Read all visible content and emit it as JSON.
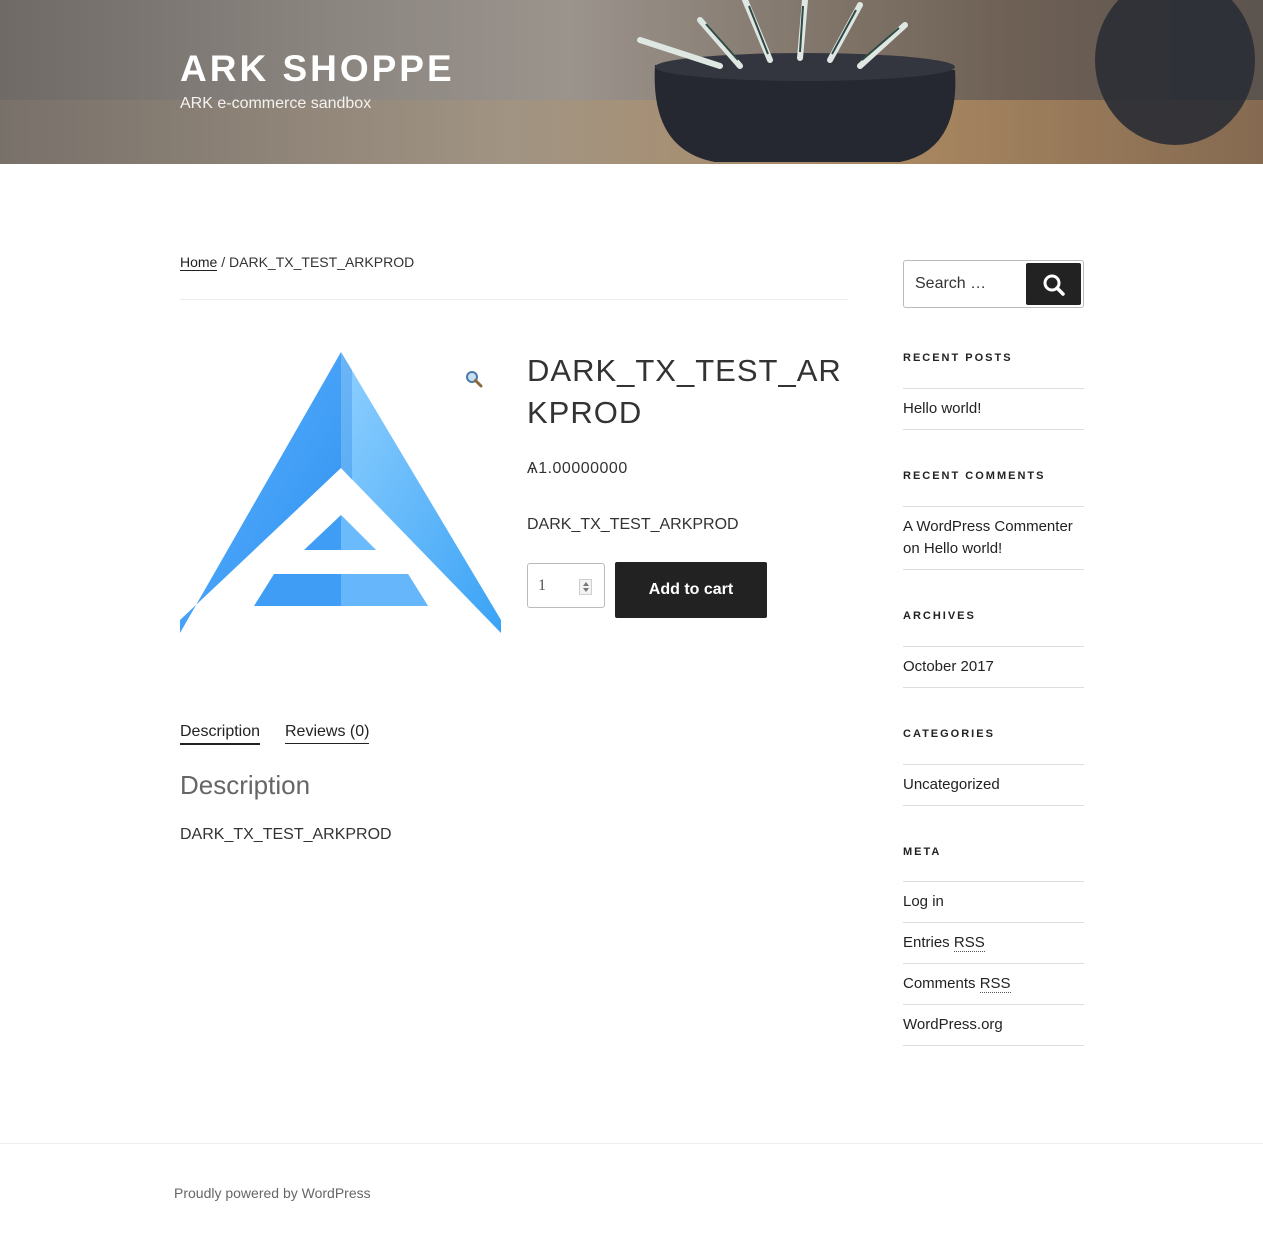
{
  "site": {
    "title": "ARK SHOPPE",
    "description": "ARK e-commerce sandbox"
  },
  "breadcrumb": {
    "home": "Home",
    "separator": " / ",
    "current": "DARK_TX_TEST_ARKPROD"
  },
  "product": {
    "title": "DARK_TX_TEST_ARKPROD",
    "price": "Ѧ1.00000000",
    "short_description": "DARK_TX_TEST_ARKPROD",
    "quantity": "1",
    "add_to_cart_label": "Add to cart",
    "image_icon": "ark-logo",
    "zoom_icon": "magnifier-icon",
    "brand_color": "#3a9bf0"
  },
  "tabs": [
    {
      "label": "Description",
      "active": true
    },
    {
      "label": "Reviews (0)",
      "active": false
    }
  ],
  "description": {
    "heading": "Description",
    "body": "DARK_TX_TEST_ARKPROD"
  },
  "sidebar": {
    "search": {
      "placeholder": "Search …",
      "button_icon": "search-icon"
    },
    "recent_posts": {
      "title": "RECENT POSTS",
      "items": [
        "Hello world!"
      ]
    },
    "recent_comments": {
      "title": "RECENT COMMENTS",
      "author": "A WordPress Commenter",
      "connector": " on ",
      "post": "Hello world!"
    },
    "archives": {
      "title": "ARCHIVES",
      "items": [
        "October 2017"
      ]
    },
    "categories": {
      "title": "CATEGORIES",
      "items": [
        "Uncategorized"
      ]
    },
    "meta": {
      "title": "META",
      "login": "Log in",
      "entries_prefix": "Entries ",
      "comments_prefix": "Comments ",
      "rss": "RSS",
      "wordpress": "WordPress.org"
    }
  },
  "footer": {
    "credit": "Proudly powered by WordPress"
  }
}
